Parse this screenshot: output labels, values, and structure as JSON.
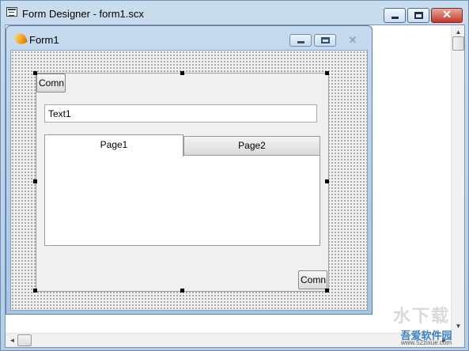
{
  "outer_window": {
    "title": "Form Designer - form1.scx",
    "minimize_glyph": "",
    "maximize_glyph": "",
    "close_glyph": "✕"
  },
  "form1": {
    "title": "Form1",
    "close_glyph": "✕"
  },
  "controls": {
    "command_top_label": "Comn",
    "command_bottom_label": "Comn",
    "text_box_value": "Text1",
    "tabs": [
      {
        "label": "Page1",
        "active": true
      },
      {
        "label": "Page2",
        "active": false
      }
    ]
  },
  "scrollbars": {
    "up_arrow": "▲",
    "down_arrow": "▼",
    "left_arrow": "◄",
    "right_arrow": "►"
  },
  "watermark": {
    "logo": "水下载",
    "brand": "吾爱软件园",
    "url": "www.52zixue.com"
  },
  "icons": {
    "outer_app_icon": "form-designer-icon",
    "form1_icon": "vfp-fox-icon"
  },
  "colors": {
    "titlebar": "#c9dced",
    "close_button": "#c0392b",
    "grid_background": "#f0f0f0"
  }
}
